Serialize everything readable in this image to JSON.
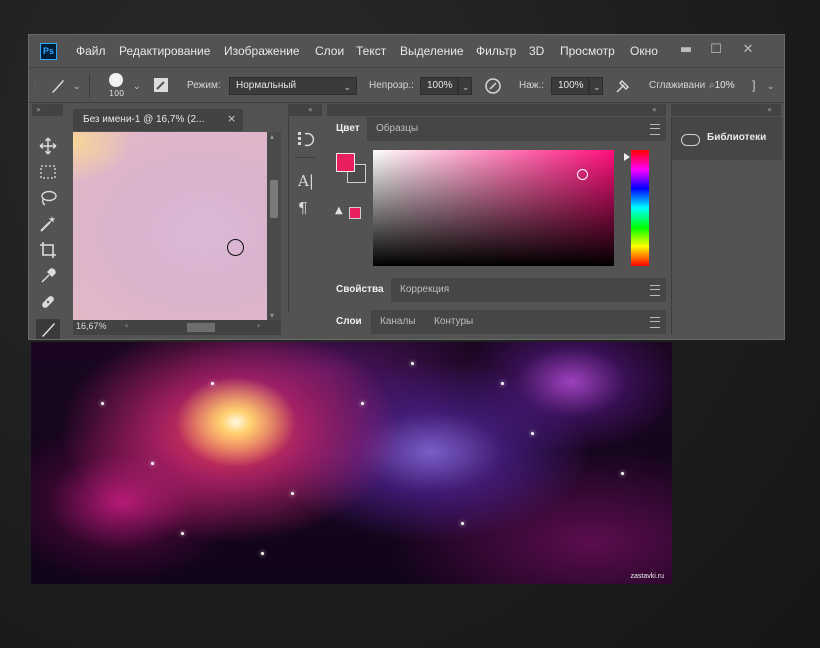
{
  "app": {
    "logo": "Ps"
  },
  "menu": [
    "Файл",
    "Редактирование",
    "Изображение",
    "Слои",
    "Текст",
    "Выделение",
    "Фильтр",
    "3D",
    "Просмотр",
    "Окно"
  ],
  "window_controls": {
    "minimize": "▬",
    "maximize": "☐",
    "close": "✕"
  },
  "options": {
    "brush_size": "100",
    "mode_label": "Режим:",
    "mode_value": "Нормальный",
    "opacity_label": "Непрозр.:",
    "opacity_value": "100%",
    "flow_label": "Наж.:",
    "flow_value": "100%",
    "smoothing_label": "Сглаживани",
    "smoothing_value": "10%"
  },
  "document": {
    "title": "Без имени-1 @ 16,7% (2...",
    "close": "×",
    "zoom": "16,67%"
  },
  "panels": {
    "color_tabs": [
      "Цвет",
      "Образцы"
    ],
    "properties_tabs": [
      "Свойства",
      "Коррекция"
    ],
    "layers_tabs": [
      "Слои",
      "Каналы",
      "Контуры"
    ],
    "libraries_title": "Библиотеки"
  },
  "colors": {
    "foreground": "#e8205e",
    "background": "#4b4b4b",
    "hue": "#ff0f7b"
  },
  "icons": {
    "tools": [
      "move-tool",
      "marquee-tool",
      "lasso-tool",
      "magic-wand-tool",
      "crop-tool",
      "eyedropper-tool",
      "healing-brush-tool",
      "brush-tool"
    ],
    "panel_strip": [
      "history-icon",
      "character-icon",
      "paragraph-icon"
    ]
  },
  "watermark": "zastavki.ru"
}
